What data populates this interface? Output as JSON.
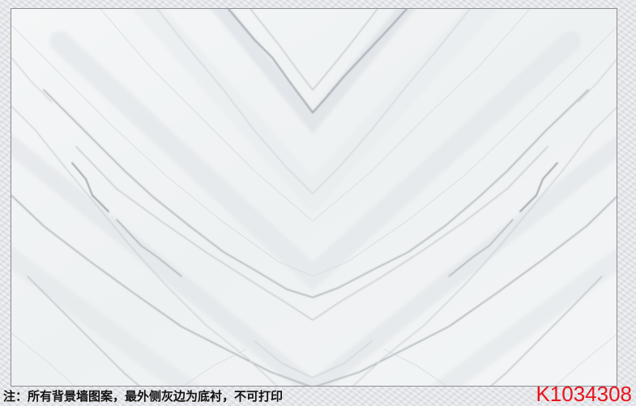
{
  "image": {
    "subject": "white-marble-bookmatched-slab",
    "vein_pattern": "chevron-pointing-down",
    "colors": {
      "marble_base": "#f2f4f5",
      "vein_dark": "#9aa0a6",
      "vein_light": "#c9cfd4",
      "backing": "#e6e7ec",
      "note_text": "#111111",
      "code_text": "#e8141c"
    }
  },
  "caption": {
    "note": "注：所有背景墙图案，最外侧灰边为底衬，不可打印",
    "code": "K1034308"
  }
}
